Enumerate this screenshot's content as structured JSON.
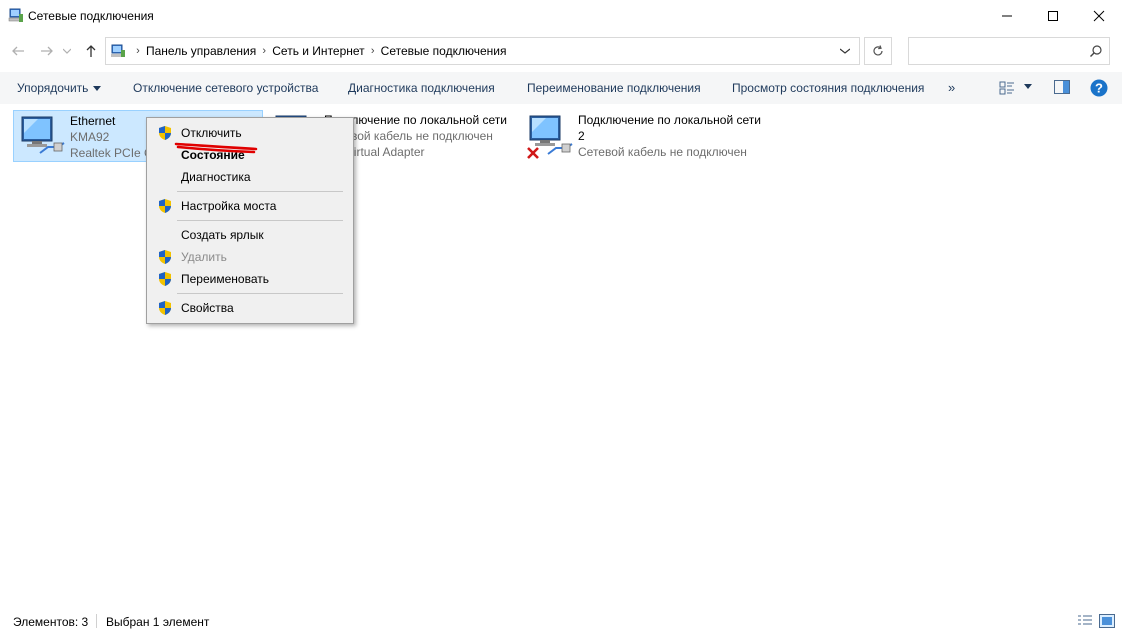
{
  "window": {
    "title": "Сетевые подключения"
  },
  "address": {
    "crumbs": [
      "Панель управления",
      "Сеть и Интернет",
      "Сетевые подключения"
    ],
    "search_placeholder": ""
  },
  "toolbar": {
    "organize": "Упорядочить",
    "disable_device": "Отключение сетевого устройства",
    "diagnose": "Диагностика подключения",
    "rename": "Переименование подключения",
    "view_status": "Просмотр состояния подключения",
    "more": "»"
  },
  "items": [
    {
      "name": "Ethernet",
      "status": "KMA92",
      "device": "Realtek PCIe G",
      "selected": true,
      "disconnected": false
    },
    {
      "name": "Подключение по локальной сети",
      "status": "Сетевой кабель не подключен",
      "device": "dify Virtual Adapter",
      "selected": false,
      "disconnected": false
    },
    {
      "name": "Подключение по локальной сети",
      "status": "2",
      "device": "Сетевой кабель не подключен",
      "selected": false,
      "disconnected": true
    }
  ],
  "context_menu": {
    "items": [
      {
        "label": "Отключить",
        "shield": true,
        "bold": false,
        "disabled": false
      },
      {
        "label": "Состояние",
        "shield": false,
        "bold": true,
        "disabled": false
      },
      {
        "label": "Диагностика",
        "shield": false,
        "bold": false,
        "disabled": false
      },
      {
        "label": "Настройка моста",
        "shield": true,
        "bold": false,
        "disabled": false
      },
      {
        "label": "Создать ярлык",
        "shield": false,
        "bold": false,
        "disabled": false
      },
      {
        "label": "Удалить",
        "shield": true,
        "bold": false,
        "disabled": true
      },
      {
        "label": "Переименовать",
        "shield": true,
        "bold": false,
        "disabled": false
      },
      {
        "label": "Свойства",
        "shield": true,
        "bold": false,
        "disabled": false
      }
    ]
  },
  "statusbar": {
    "count": "Элементов: 3",
    "selected": "Выбран 1 элемент"
  },
  "colors": {
    "accent": "#0078d7",
    "selection_bg": "#cce8ff",
    "annotation": "#e00000"
  }
}
